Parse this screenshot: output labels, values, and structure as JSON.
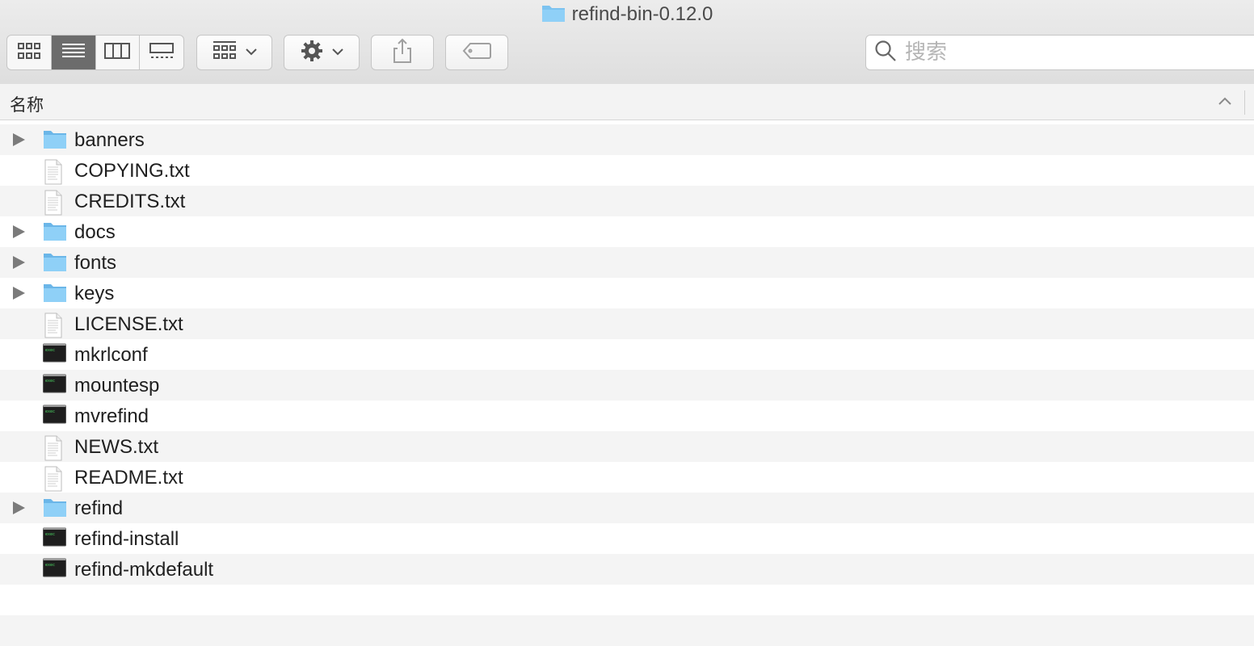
{
  "window": {
    "title": "refind-bin-0.12.0"
  },
  "toolbar": {
    "view_modes": [
      {
        "name": "icon-view",
        "icon": "icon-grid-icon",
        "active": false
      },
      {
        "name": "list-view",
        "icon": "list-icon",
        "active": true
      },
      {
        "name": "column-view",
        "icon": "columns-icon",
        "active": false
      },
      {
        "name": "gallery-view",
        "icon": "gallery-icon",
        "active": false
      }
    ],
    "search": {
      "placeholder": "搜索"
    }
  },
  "header": {
    "name_label": "名称",
    "sort": "ascending"
  },
  "files": [
    {
      "name": "banners",
      "kind": "folder"
    },
    {
      "name": "COPYING.txt",
      "kind": "text"
    },
    {
      "name": "CREDITS.txt",
      "kind": "text"
    },
    {
      "name": "docs",
      "kind": "folder"
    },
    {
      "name": "fonts",
      "kind": "folder"
    },
    {
      "name": "keys",
      "kind": "folder"
    },
    {
      "name": "LICENSE.txt",
      "kind": "text"
    },
    {
      "name": "mkrlconf",
      "kind": "exec"
    },
    {
      "name": "mountesp",
      "kind": "exec"
    },
    {
      "name": "mvrefind",
      "kind": "exec"
    },
    {
      "name": "NEWS.txt",
      "kind": "text"
    },
    {
      "name": "README.txt",
      "kind": "text"
    },
    {
      "name": "refind",
      "kind": "folder"
    },
    {
      "name": "refind-install",
      "kind": "exec"
    },
    {
      "name": "refind-mkdefault",
      "kind": "exec"
    }
  ],
  "colors": {
    "folder": "#7cc3f0",
    "accent_active": "#6c6c6c",
    "row_alt": "#f4f4f4"
  }
}
